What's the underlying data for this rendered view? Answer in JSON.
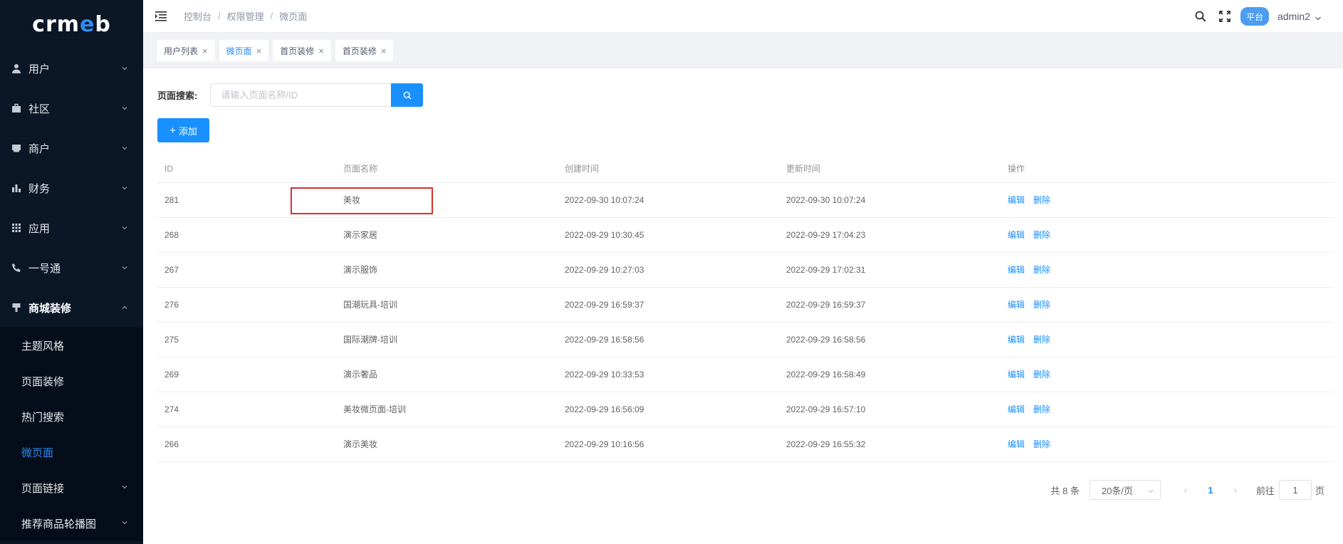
{
  "app": {
    "logo_parts": [
      "crm",
      "e",
      "b"
    ]
  },
  "sidebar": {
    "items": [
      {
        "label": "用户",
        "icon": "user-icon"
      },
      {
        "label": "社区",
        "icon": "briefcase-icon"
      },
      {
        "label": "商户",
        "icon": "store-icon"
      },
      {
        "label": "财务",
        "icon": "bar-chart-icon"
      },
      {
        "label": "应用",
        "icon": "grid-icon"
      },
      {
        "label": "一号通",
        "icon": "phone-icon"
      },
      {
        "label": "商城装修",
        "icon": "brush-icon"
      }
    ],
    "submenu": [
      {
        "label": "主题风格"
      },
      {
        "label": "页面装修"
      },
      {
        "label": "热门搜索"
      },
      {
        "label": "微页面"
      },
      {
        "label": "页面链接"
      },
      {
        "label": "推荐商品轮播图"
      }
    ]
  },
  "header": {
    "breadcrumb": [
      "控制台",
      "权限管理",
      "微页面"
    ],
    "platform_badge": "平台",
    "username": "admin2"
  },
  "tabs": [
    {
      "label": "用户列表"
    },
    {
      "label": "微页面"
    },
    {
      "label": "首页装修"
    },
    {
      "label": "首页装修"
    }
  ],
  "search": {
    "label": "页面搜索:",
    "placeholder": "请输入页面名称/ID"
  },
  "add_button": "添加",
  "table": {
    "headers": [
      "ID",
      "页面名称",
      "创建时间",
      "更新时间",
      "操作"
    ],
    "rows": [
      {
        "id": "281",
        "name": "美妆",
        "created": "2022-09-30 10:07:24",
        "updated": "2022-09-30 10:07:24"
      },
      {
        "id": "268",
        "name": "演示家居",
        "created": "2022-09-29 10:30:45",
        "updated": "2022-09-29 17:04:23"
      },
      {
        "id": "267",
        "name": "演示服饰",
        "created": "2022-09-29 10:27:03",
        "updated": "2022-09-29 17:02:31"
      },
      {
        "id": "276",
        "name": "国潮玩具-培训",
        "created": "2022-09-29 16:59:37",
        "updated": "2022-09-29 16:59:37"
      },
      {
        "id": "275",
        "name": "国际潮牌-培训",
        "created": "2022-09-29 16:58:56",
        "updated": "2022-09-29 16:58:56"
      },
      {
        "id": "269",
        "name": "演示奢品",
        "created": "2022-09-29 10:33:53",
        "updated": "2022-09-29 16:58:49"
      },
      {
        "id": "274",
        "name": "美妆微页面-培训",
        "created": "2022-09-29 16:56:09",
        "updated": "2022-09-29 16:57:10"
      },
      {
        "id": "266",
        "name": "演示美妆",
        "created": "2022-09-29 10:16:56",
        "updated": "2022-09-29 16:55:32"
      }
    ],
    "edit_label": "编辑",
    "delete_label": "删除"
  },
  "pagination": {
    "total": "共 8 条",
    "page_size": "20条/页",
    "current_page": "1",
    "goto_label": "前往",
    "goto_value": "1",
    "page_suffix": "页"
  },
  "colors": {
    "primary": "#1890ff",
    "sidebar_bg": "#0b1627",
    "highlight": "#e02d2d"
  }
}
